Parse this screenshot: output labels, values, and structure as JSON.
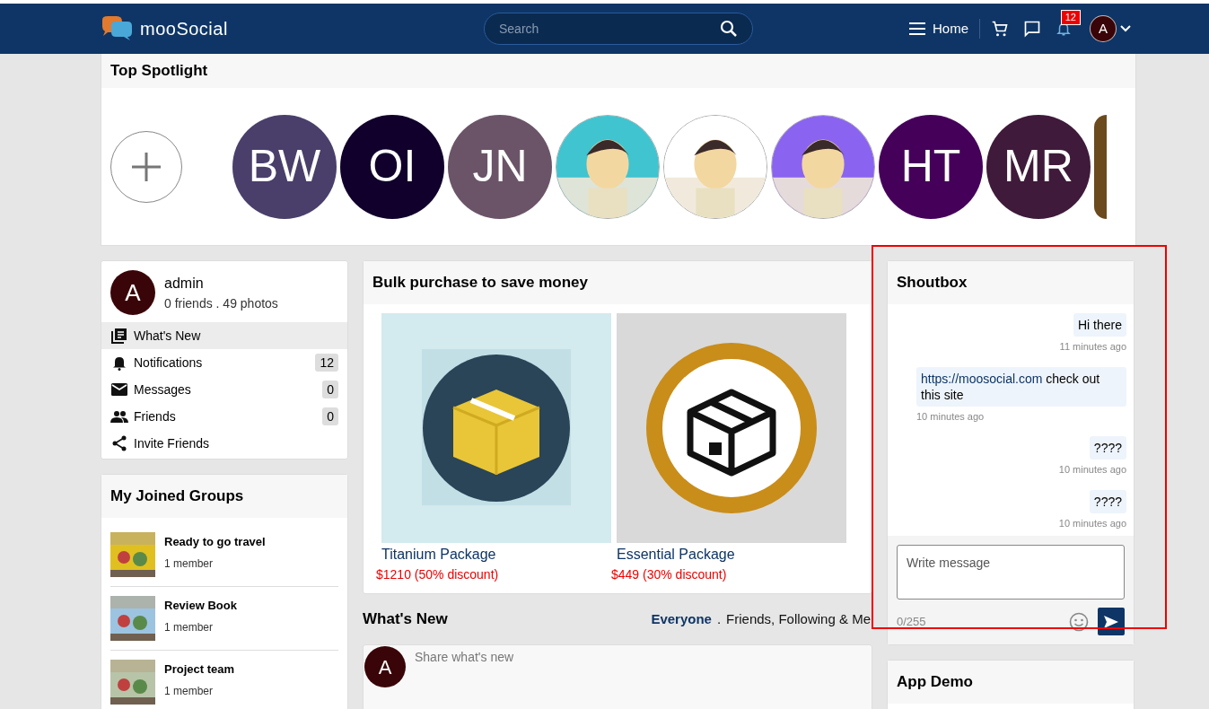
{
  "header": {
    "brand": "mooSocial",
    "search": {
      "placeholder": "Search"
    },
    "home": "Home",
    "notification_count": "12",
    "avatar": "A"
  },
  "spotlight": {
    "title": "Top Spotlight",
    "items": [
      {
        "kind": "initials",
        "text": "BW",
        "color": "#4a3f6b"
      },
      {
        "kind": "initials",
        "text": "OI",
        "color": "#10002b"
      },
      {
        "kind": "initials",
        "text": "JN",
        "color": "#6b5468"
      },
      {
        "kind": "picture",
        "color": "#3fc4d0"
      },
      {
        "kind": "picture",
        "color": "#ffffff"
      },
      {
        "kind": "picture",
        "color": "#8a63f0"
      },
      {
        "kind": "initials",
        "text": "HT",
        "color": "#45005a"
      },
      {
        "kind": "initials",
        "text": "MR",
        "color": "#3f1a3a"
      },
      {
        "kind": "partial",
        "color": "#6b4a1e"
      }
    ]
  },
  "profile": {
    "avatar": "A",
    "name": "admin",
    "stats": "0 friends . 49 photos",
    "menu": [
      {
        "label": "What's New",
        "selected": true
      },
      {
        "label": "Notifications",
        "count": "12",
        "selected": false
      },
      {
        "label": "Messages",
        "count": "0",
        "selected": false
      },
      {
        "label": "Friends",
        "count": "0",
        "selected": false
      },
      {
        "label": "Invite Friends",
        "selected": false
      }
    ]
  },
  "groups": {
    "title": "My Joined Groups",
    "items": [
      {
        "name": "Ready to go travel",
        "members": "1 member"
      },
      {
        "name": "Review Book",
        "members": "1 member"
      },
      {
        "name": "Project team",
        "members": "1 member"
      }
    ]
  },
  "bulk": {
    "title": "Bulk purchase to save money",
    "packages": [
      {
        "kind": "filled",
        "name": "Titanium Package",
        "price": "$1210 (50% discount)"
      },
      {
        "kind": "ring",
        "name": "Essential Package",
        "price": "$449 (30% discount)"
      }
    ]
  },
  "whats_new": {
    "title": "What's New",
    "separator": ".",
    "filters": [
      {
        "label": "Everyone",
        "selected": true
      },
      {
        "label": "Friends, Following & Me",
        "selected": false
      }
    ],
    "avatar": "A",
    "placeholder": "Share what's new"
  },
  "shoutbox": {
    "title": "Shoutbox",
    "highlighted": true,
    "messages": [
      {
        "kind": "self",
        "text": "Hi there",
        "time": "11 minutes ago"
      },
      {
        "kind": "other",
        "link": "https://moosocial.com",
        "text": "check out this site",
        "time": "10 minutes ago"
      },
      {
        "kind": "self",
        "text": "????",
        "time": "10 minutes ago"
      },
      {
        "kind": "self",
        "text": "????",
        "time": "10 minutes ago"
      }
    ],
    "placeholder": "Write message",
    "counter": "0/255"
  },
  "app_demo": {
    "title": "App Demo"
  }
}
